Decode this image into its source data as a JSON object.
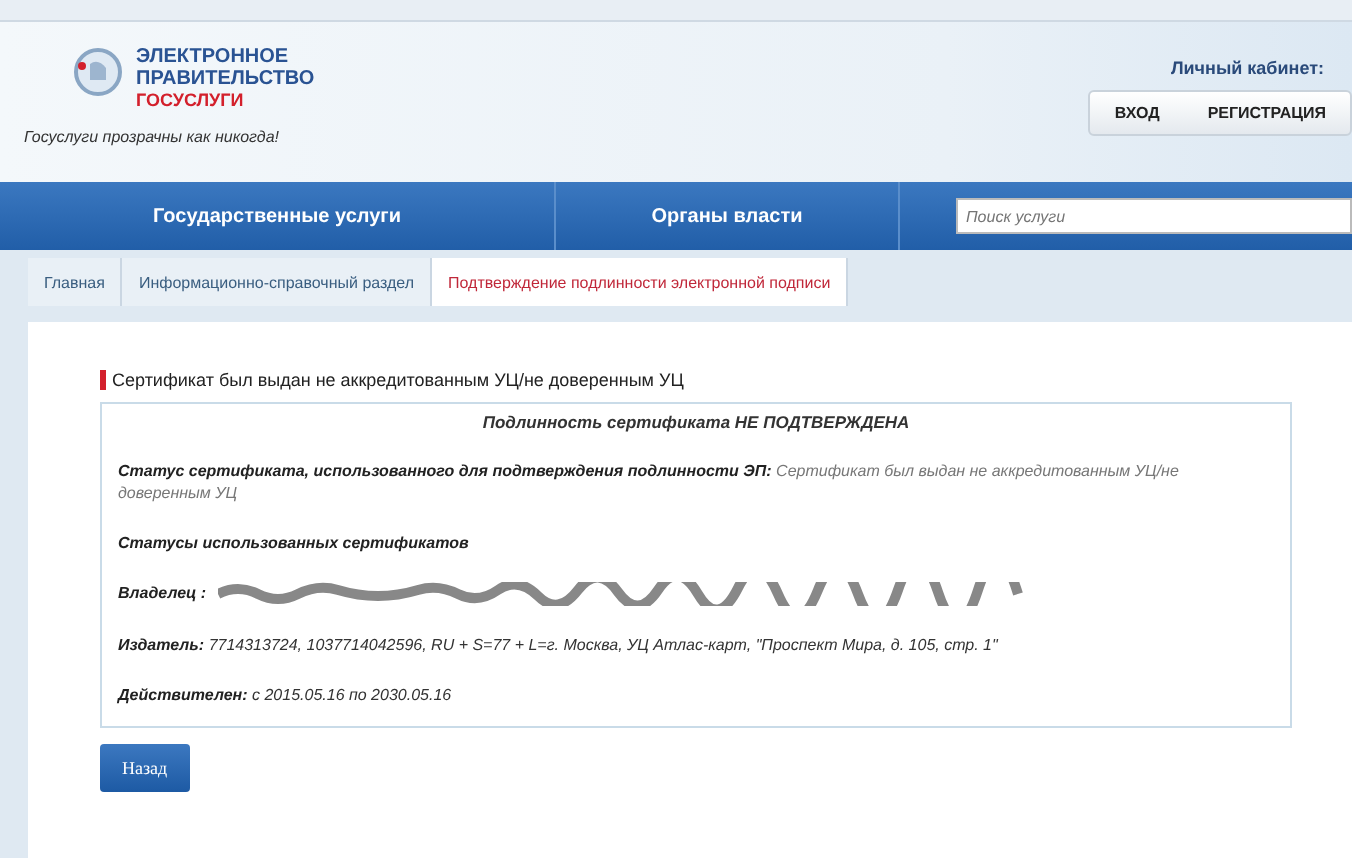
{
  "header": {
    "logo_lines": [
      "ЭЛЕКТРОННОЕ",
      "ПРАВИТЕЛЬСТВО",
      "ГОСУСЛУГИ"
    ],
    "tagline": "Госуслуги прозрачны как никогда!",
    "account_label": "Личный кабинет:",
    "account_buttons": [
      "ВХОД",
      "РЕГИСТРАЦИЯ"
    ]
  },
  "nav": {
    "items": [
      "Государственные услуги",
      "Органы власти"
    ],
    "search": {
      "placeholder": "Поиск услуги"
    }
  },
  "breadcrumbs": [
    {
      "label": "Главная",
      "selected": false
    },
    {
      "label": "Информационно-справочный раздел",
      "selected": false
    },
    {
      "label": "Подтверждение подлинности электронной подписи",
      "selected": true
    }
  ],
  "notice": "Сертификат был выдан не аккредитованным УЦ/не доверенным УЦ",
  "result": {
    "title": "Подлинность сертификата НЕ ПОДТВЕРЖДЕНА",
    "status_label": "Статус сертификата, использованного для подтверждения подлинности ЭП:",
    "status_value": "Сертификат был выдан не аккредитованным УЦ/не доверенным УЦ",
    "statuses_heading": "Статусы использованных сертификатов",
    "fields": [
      {
        "kind": "redacted",
        "label": "Владелец :"
      },
      {
        "kind": "text",
        "label": "Издатель:",
        "value": "7714313724, 1037714042596, RU + S=77 + L=г. Москва, УЦ Атлас-карт, \"Проспект Мира, д. 105, стр. 1\""
      },
      {
        "kind": "text",
        "label": "Действителен:",
        "value": "с 2015.05.16 по 2030.05.16"
      }
    ]
  },
  "back_button": "Назад"
}
